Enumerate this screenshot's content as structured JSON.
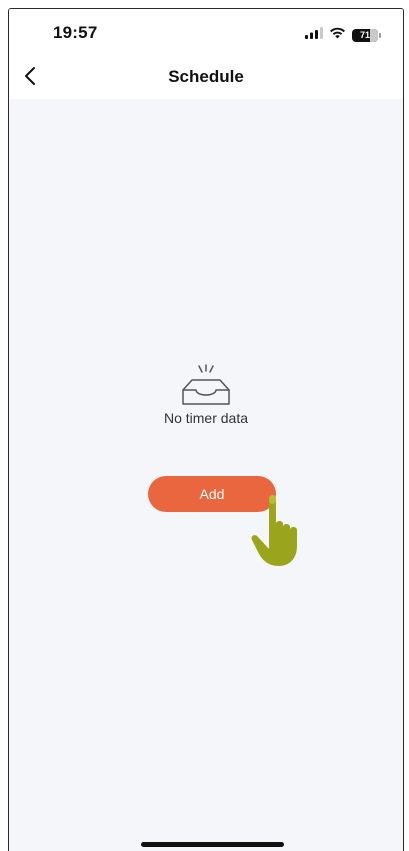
{
  "status_bar": {
    "time": "19:57",
    "battery_percent": "71",
    "battery_level": 0.71,
    "icons": [
      "cellular-signal-icon",
      "wifi-icon",
      "battery-icon"
    ]
  },
  "nav": {
    "title": "Schedule",
    "back_icon": "chevron-left-icon"
  },
  "empty_state": {
    "icon": "empty-tray-icon",
    "message": "No timer data"
  },
  "actions": {
    "add_label": "Add"
  },
  "overlay": {
    "pointer_icon": "hand-pointer-icon"
  },
  "colors": {
    "accent": "#e9663f",
    "background": "#f4f6f9",
    "pointer": "#9aa51c"
  }
}
